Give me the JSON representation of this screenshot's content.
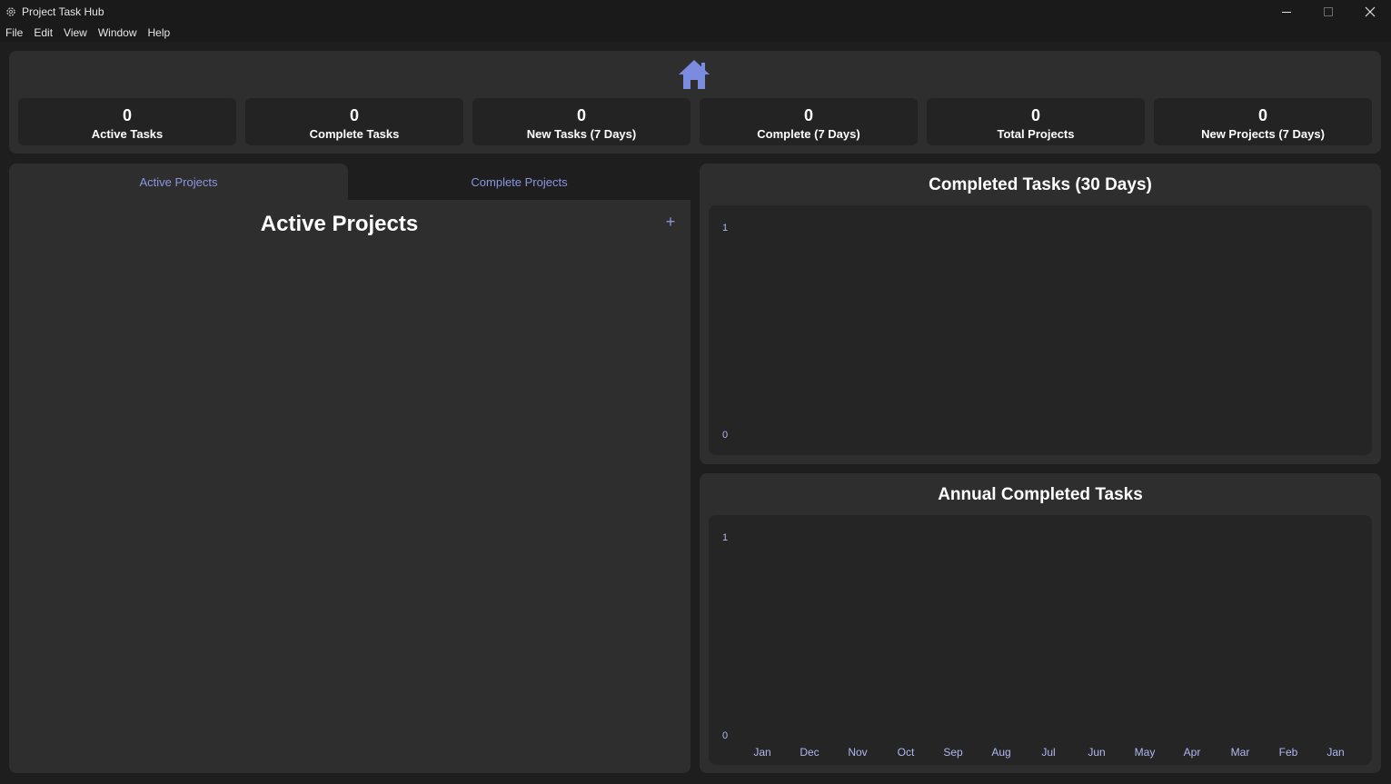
{
  "window": {
    "title": "Project Task Hub",
    "app_icon": "gear-icon",
    "controls": [
      "minimize-icon",
      "maximize-icon",
      "close-icon"
    ]
  },
  "menu": [
    "File",
    "Edit",
    "View",
    "Window",
    "Help"
  ],
  "header": {
    "icon": "home-icon",
    "accent_color": "#7b8be0",
    "stats": [
      {
        "value": "0",
        "label": "Active Tasks"
      },
      {
        "value": "0",
        "label": "Complete Tasks"
      },
      {
        "value": "0",
        "label": "New Tasks (7 Days)"
      },
      {
        "value": "0",
        "label": "Complete (7 Days)"
      },
      {
        "value": "0",
        "label": "Total Projects"
      },
      {
        "value": "0",
        "label": "New Projects (7 Days)"
      }
    ]
  },
  "projects": {
    "tabs": [
      {
        "label": "Active Projects",
        "active": true
      },
      {
        "label": "Complete Projects",
        "active": false
      }
    ],
    "title": "Active Projects",
    "add_label": "+"
  },
  "charts": {
    "completed_30": {
      "title": "Completed Tasks (30 Days)",
      "y_ticks": [
        "1",
        "0"
      ]
    },
    "annual": {
      "title": "Annual Completed Tasks",
      "y_ticks": [
        "1",
        "0"
      ],
      "x_ticks": [
        "Jan",
        "Dec",
        "Nov",
        "Oct",
        "Sep",
        "Aug",
        "Jul",
        "Jun",
        "May",
        "Apr",
        "Mar",
        "Feb",
        "Jan"
      ]
    }
  }
}
